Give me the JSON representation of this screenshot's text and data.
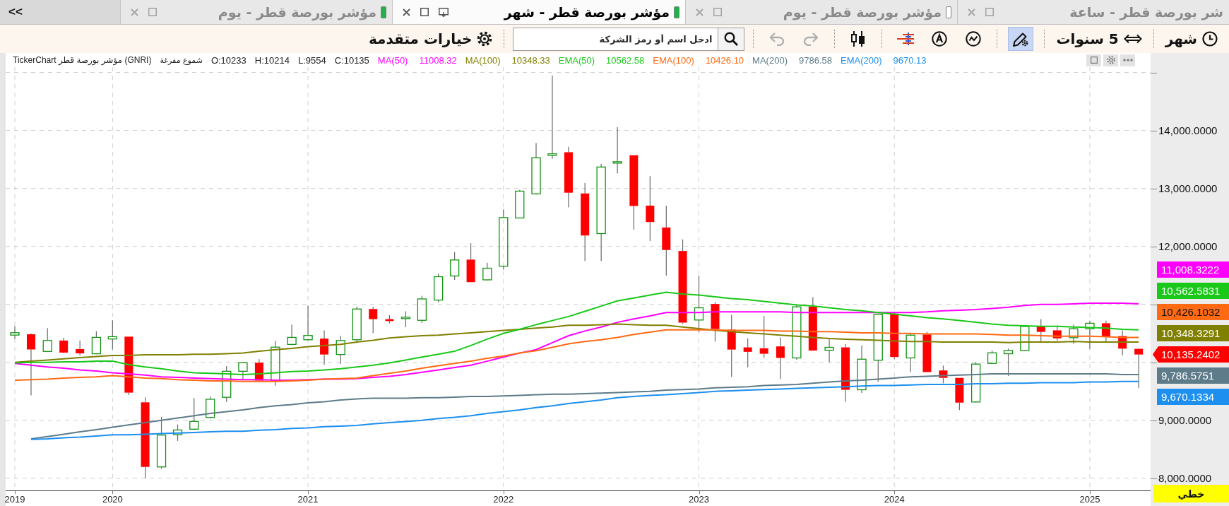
{
  "tabs": [
    {
      "label": "شر بورصة قطر - ساعة",
      "selected": false
    },
    {
      "label": "مؤشر بورصة قطر - يوم",
      "selected": false,
      "color": "#ffffff"
    },
    {
      "label": "مؤشر بورصة قطر - شهر",
      "selected": true,
      "color": "#1fb24a"
    },
    {
      "label": "مؤشر بورصة قطر - يوم",
      "selected": false,
      "color": "#1fb24a"
    }
  ],
  "tab_scroll": {
    "label": "<<"
  },
  "toolbar": {
    "period": {
      "label": "شهر"
    },
    "range": {
      "label": "5 سنوات"
    },
    "draw_tool": {
      "selected": true
    },
    "redo": {
      "disabled": true
    },
    "undo": {
      "disabled": true
    },
    "search": {
      "placeholder": "ادخل اسم أو رمز الشركة"
    },
    "advanced": {
      "label": "خيارات متقدمة"
    }
  },
  "chart": {
    "legend": {
      "title": "TickerChart مؤشر بورصة قطر (GNRI)",
      "style": "شموع مفرغة",
      "ohlc": [
        "O:10233",
        "H:10214",
        "L:9554",
        "C:10135"
      ],
      "indicator_values": [
        "11008.32",
        "10348.33",
        "10562.58",
        "10426.10",
        "9786.58",
        "9670.13"
      ]
    },
    "chart_data": {
      "type": "candlestick",
      "grid": true,
      "x": [
        2019.5,
        2019.583,
        2019.667,
        2019.75,
        2019.833,
        2019.917,
        2020,
        2020.083,
        2020.167,
        2020.25,
        2020.333,
        2020.417,
        2020.5,
        2020.583,
        2020.667,
        2020.75,
        2020.833,
        2020.917,
        2021,
        2021.083,
        2021.167,
        2021.25,
        2021.333,
        2021.417,
        2021.5,
        2021.583,
        2021.667,
        2021.75,
        2021.833,
        2021.917,
        2022,
        2022.083,
        2022.167,
        2022.25,
        2022.333,
        2022.417,
        2022.5,
        2022.583,
        2022.667,
        2022.75,
        2022.833,
        2022.917,
        2023,
        2023.083,
        2023.167,
        2023.25,
        2023.333,
        2023.417,
        2023.5,
        2023.583,
        2023.667,
        2023.75,
        2023.833,
        2023.917,
        2024,
        2024.083,
        2024.167,
        2024.25,
        2024.333,
        2024.417,
        2024.5,
        2024.583,
        2024.667,
        2024.75,
        2024.833,
        2024.917,
        2025,
        2025.083,
        2025.167,
        2025.25
      ],
      "xlim": [
        2019.453,
        2025.311
      ],
      "xticks": [
        {
          "value": 2019.5,
          "label": "2019"
        },
        2020,
        2021,
        2022,
        2023,
        2024,
        2025
      ],
      "ylim": [
        7790,
        15092
      ],
      "yticks": [
        {
          "value": 8000,
          "label": "8,000.0000"
        },
        {
          "value": 9000,
          "label": "9,000.0000"
        },
        {
          "value": 12000,
          "label": "12,000.0000"
        },
        {
          "value": 13000,
          "label": "13,000.0000"
        },
        {
          "value": 14000,
          "label": "14,000.0000"
        }
      ],
      "ohlc": [
        [
          10470,
          10625,
          10403,
          10511
        ],
        [
          10484,
          10500,
          9430,
          10222
        ],
        [
          10188,
          10591,
          10175,
          10376
        ],
        [
          10376,
          10424,
          10155,
          10168
        ],
        [
          10229,
          10376,
          10121,
          10155
        ],
        [
          10148,
          10537,
          10141,
          10430
        ],
        [
          10403,
          10725,
          10222,
          10443
        ],
        [
          10443,
          10443,
          9437,
          9477
        ],
        [
          9310,
          9397,
          7995,
          8196
        ],
        [
          8196,
          9061,
          8162,
          8746
        ],
        [
          8753,
          8927,
          8645,
          8833
        ],
        [
          8847,
          9383,
          8833,
          8981
        ],
        [
          9048,
          9410,
          9034,
          9363
        ],
        [
          9397,
          9934,
          9316,
          9846
        ],
        [
          9846,
          10001,
          9705,
          9994
        ],
        [
          9994,
          10054,
          9665,
          9685
        ],
        [
          9679,
          10370,
          9598,
          10262
        ],
        [
          10309,
          10652,
          10296,
          10430
        ],
        [
          10390,
          10974,
          10376,
          10463
        ],
        [
          10410,
          10551,
          9960,
          10135
        ],
        [
          10135,
          10457,
          9974,
          10376
        ],
        [
          10390,
          10960,
          10336,
          10920
        ],
        [
          10920,
          10960,
          10504,
          10745
        ],
        [
          10745,
          10813,
          10672,
          10712
        ],
        [
          10759,
          10880,
          10605,
          10779
        ],
        [
          10725,
          11148,
          10678,
          11094
        ],
        [
          11074,
          11531,
          11034,
          11477
        ],
        [
          11490,
          11900,
          11423,
          11766
        ],
        [
          11772,
          12054,
          11383,
          11383
        ],
        [
          11423,
          11718,
          11410,
          11624
        ],
        [
          11658,
          12638,
          11598,
          12497
        ],
        [
          12490,
          12973,
          12490,
          12953
        ],
        [
          12906,
          13785,
          12893,
          13530
        ],
        [
          13571,
          14950,
          13510,
          13597
        ],
        [
          13624,
          13718,
          12671,
          12926
        ],
        [
          12913,
          13094,
          11745,
          12188
        ],
        [
          12221,
          13423,
          11745,
          13369
        ],
        [
          13440,
          14055,
          13257,
          13460
        ],
        [
          13573,
          13573,
          12287,
          12697
        ],
        [
          12703,
          13213,
          12093,
          12420
        ],
        [
          12326,
          12703,
          11495,
          11938
        ],
        [
          11921,
          12121,
          10663,
          10685
        ],
        [
          10730,
          11495,
          10519,
          10941
        ],
        [
          11007,
          11040,
          10358,
          10575
        ],
        [
          10563,
          10818,
          9749,
          10220
        ],
        [
          10258,
          10414,
          9915,
          10181
        ],
        [
          10242,
          10802,
          10081,
          10148
        ],
        [
          10275,
          10430,
          9710,
          10076
        ],
        [
          10076,
          10985,
          10042,
          10957
        ],
        [
          10963,
          11123,
          10203,
          10203
        ],
        [
          10209,
          10403,
          9998,
          10258
        ],
        [
          10258,
          10314,
          9316,
          9527
        ],
        [
          9527,
          10292,
          9472,
          10054
        ],
        [
          10037,
          10840,
          9665,
          10829
        ],
        [
          10840,
          10874,
          10054,
          10092
        ],
        [
          10076,
          10497,
          9832,
          10469
        ],
        [
          10480,
          10525,
          9832,
          9832
        ],
        [
          9860,
          9943,
          9638,
          9732
        ],
        [
          9732,
          9732,
          9178,
          9305
        ],
        [
          9316,
          9998,
          9305,
          9970
        ],
        [
          9981,
          10203,
          9970,
          10164
        ],
        [
          10148,
          10236,
          9765,
          10203
        ],
        [
          10203,
          10635,
          10192,
          10619
        ],
        [
          10619,
          10746,
          10358,
          10525
        ],
        [
          10552,
          10635,
          10375,
          10414
        ],
        [
          10425,
          10650,
          10320,
          10580
        ],
        [
          10580,
          10718,
          10231,
          10674
        ],
        [
          10674,
          10718,
          10358,
          10441
        ],
        [
          10453,
          10552,
          10120,
          10236
        ],
        [
          10233,
          10233,
          9554,
          10135
        ]
      ],
      "series": [
        {
          "name": "MA(50)",
          "type": "line",
          "color": "#ff00ff",
          "values": [
            9980,
            9950,
            9920,
            9900,
            9870,
            9850,
            9820,
            9800,
            9780,
            9750,
            9740,
            9730,
            9720,
            9710,
            9700,
            9700,
            9690,
            9690,
            9700,
            9710,
            9710,
            9720,
            9740,
            9760,
            9790,
            9830,
            9870,
            9910,
            9950,
            10020,
            10090,
            10160,
            10220,
            10340,
            10460,
            10540,
            10610,
            10690,
            10750,
            10800,
            10860,
            10860,
            10860,
            10870,
            10870,
            10870,
            10870,
            10870,
            10860,
            10860,
            10860,
            10860,
            10860,
            10860,
            10860,
            10860,
            10870,
            10890,
            10900,
            10910,
            10930,
            10950,
            10980,
            11000,
            11000,
            11010,
            11020,
            11020,
            11020,
            11010
          ]
        },
        {
          "name": "MA(100)",
          "type": "line",
          "color": "#808000",
          "values": [
            10000,
            10020,
            10040,
            10060,
            10080,
            10100,
            10120,
            10120,
            10130,
            10130,
            10130,
            10140,
            10140,
            10150,
            10160,
            10190,
            10220,
            10240,
            10270,
            10290,
            10310,
            10350,
            10380,
            10420,
            10440,
            10460,
            10470,
            10490,
            10510,
            10530,
            10550,
            10570,
            10590,
            10610,
            10640,
            10640,
            10650,
            10660,
            10650,
            10640,
            10640,
            10610,
            10580,
            10550,
            10530,
            10510,
            10490,
            10470,
            10450,
            10430,
            10410,
            10400,
            10390,
            10380,
            10370,
            10360,
            10360,
            10350,
            10350,
            10350,
            10350,
            10340,
            10350,
            10350,
            10350,
            10360,
            10350,
            10350,
            10350,
            10350
          ]
        },
        {
          "name": "EMA(50)",
          "type": "line",
          "color": "#19c819",
          "values": [
            9990,
            10000,
            10000,
            10010,
            10010,
            10020,
            10020,
            9960,
            9920,
            9890,
            9850,
            9820,
            9810,
            9800,
            9790,
            9800,
            9820,
            9840,
            9850,
            9870,
            9890,
            9920,
            9950,
            9990,
            10040,
            10090,
            10140,
            10190,
            10290,
            10400,
            10500,
            10570,
            10650,
            10720,
            10790,
            10880,
            10970,
            11060,
            11110,
            11160,
            11210,
            11180,
            11160,
            11130,
            11100,
            11080,
            11050,
            11020,
            10990,
            10970,
            10940,
            10910,
            10890,
            10860,
            10830,
            10800,
            10770,
            10750,
            10720,
            10690,
            10660,
            10640,
            10630,
            10620,
            10620,
            10610,
            10600,
            10590,
            10570,
            10560
          ]
        },
        {
          "name": "EMA(100)",
          "type": "line",
          "color": "#ff6a13",
          "values": [
            9690,
            9700,
            9710,
            9730,
            9740,
            9750,
            9770,
            9750,
            9730,
            9720,
            9700,
            9690,
            9680,
            9680,
            9670,
            9670,
            9670,
            9680,
            9690,
            9710,
            9720,
            9730,
            9770,
            9810,
            9850,
            9900,
            9940,
            9980,
            10020,
            10070,
            10110,
            10160,
            10200,
            10260,
            10320,
            10360,
            10390,
            10430,
            10480,
            10520,
            10560,
            10560,
            10560,
            10560,
            10550,
            10550,
            10550,
            10540,
            10540,
            10530,
            10530,
            10520,
            10510,
            10510,
            10500,
            10500,
            10490,
            10490,
            10490,
            10490,
            10480,
            10470,
            10470,
            10460,
            10450,
            10450,
            10450,
            10440,
            10430,
            10430
          ]
        },
        {
          "name": "MA(200)",
          "type": "line",
          "color": "#5d7b89",
          "values": [
            null,
            8680,
            8720,
            8760,
            8800,
            8840,
            8880,
            8920,
            8960,
            9000,
            9040,
            9080,
            9120,
            9150,
            9180,
            9220,
            9250,
            9270,
            9300,
            9320,
            9350,
            9370,
            9380,
            9380,
            9380,
            9390,
            9390,
            9400,
            9410,
            9410,
            9420,
            9430,
            9440,
            9450,
            9450,
            9460,
            9470,
            9480,
            9490,
            9500,
            9520,
            9530,
            9540,
            9560,
            9570,
            9580,
            9600,
            9610,
            9620,
            9640,
            9660,
            9680,
            9690,
            9710,
            9730,
            9750,
            9760,
            9770,
            9780,
            9790,
            9800,
            9800,
            9800,
            9800,
            9800,
            9800,
            9800,
            9800,
            9790,
            9790
          ]
        },
        {
          "name": "EMA(200)",
          "type": "line",
          "color": "#1c8fef",
          "values": [
            null,
            8670,
            8680,
            8700,
            8710,
            8730,
            8750,
            8750,
            8760,
            8770,
            8780,
            8790,
            8800,
            8810,
            8810,
            8830,
            8840,
            8860,
            8870,
            8890,
            8900,
            8910,
            8940,
            8960,
            8980,
            9000,
            9030,
            9050,
            9080,
            9120,
            9150,
            9180,
            9220,
            9250,
            9290,
            9320,
            9350,
            9390,
            9410,
            9430,
            9440,
            9460,
            9480,
            9500,
            9510,
            9520,
            9530,
            9540,
            9550,
            9560,
            9570,
            9580,
            9590,
            9600,
            9600,
            9610,
            9620,
            9620,
            9620,
            9630,
            9630,
            9640,
            9640,
            9650,
            9650,
            9650,
            9660,
            9660,
            9670,
            9670
          ]
        }
      ]
    },
    "axis_markers": [
      {
        "label": "11,008.3222",
        "color": "#ff00ff",
        "kind": "indicator"
      },
      {
        "label": "10,562.5831",
        "color": "#19c819",
        "kind": "indicator"
      },
      {
        "label": "10,426.1032",
        "color": "#ff6a13",
        "kind": "indicator"
      },
      {
        "label": "10,348.3291",
        "color": "#808000",
        "kind": "indicator"
      },
      {
        "label": "10,135.2402",
        "color": "#ff0000",
        "kind": "price"
      },
      {
        "label": "9,786.5751",
        "color": "#5d7b89",
        "kind": "indicator"
      },
      {
        "label": "9,670.1334",
        "color": "#1c8fef",
        "kind": "indicator"
      }
    ],
    "scale_button": {
      "label": "خطي"
    }
  }
}
